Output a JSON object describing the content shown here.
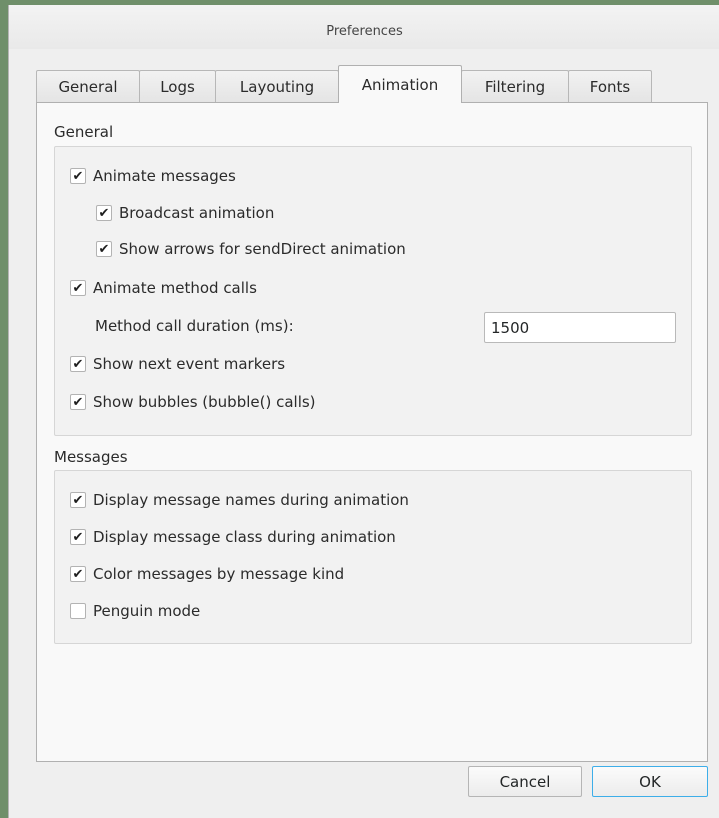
{
  "window": {
    "title": "Preferences"
  },
  "tabs": [
    {
      "label": "General",
      "active": false
    },
    {
      "label": "Logs",
      "active": false
    },
    {
      "label": "Layouting",
      "active": false
    },
    {
      "label": "Animation",
      "active": true
    },
    {
      "label": "Filtering",
      "active": false
    },
    {
      "label": "Fonts",
      "active": false
    }
  ],
  "general_section": {
    "heading": "General",
    "animate_messages": {
      "label": "Animate messages",
      "checked": true
    },
    "broadcast_animation": {
      "label": "Broadcast animation",
      "checked": true
    },
    "show_arrows": {
      "label": "Show arrows for sendDirect animation",
      "checked": true
    },
    "animate_method_calls": {
      "label": "Animate method calls",
      "checked": true
    },
    "method_call_duration": {
      "label": "Method call duration (ms):",
      "value": "1500"
    },
    "show_next_event_markers": {
      "label": "Show next event markers",
      "checked": true
    },
    "show_bubbles": {
      "label": "Show bubbles (bubble() calls)",
      "checked": true
    }
  },
  "messages_section": {
    "heading": "Messages",
    "display_names": {
      "label": "Display message names during animation",
      "checked": true
    },
    "display_class": {
      "label": "Display message class during animation",
      "checked": true
    },
    "color_by_kind": {
      "label": "Color messages by message kind",
      "checked": true
    },
    "penguin_mode": {
      "label": "Penguin mode",
      "checked": false
    }
  },
  "buttons": {
    "cancel": "Cancel",
    "ok": "OK"
  },
  "checkmark_glyph": "✔",
  "colors": {
    "focus_accent": "#3daee9",
    "panel_bg": "#f9f9f9",
    "window_bg": "#efefef"
  }
}
